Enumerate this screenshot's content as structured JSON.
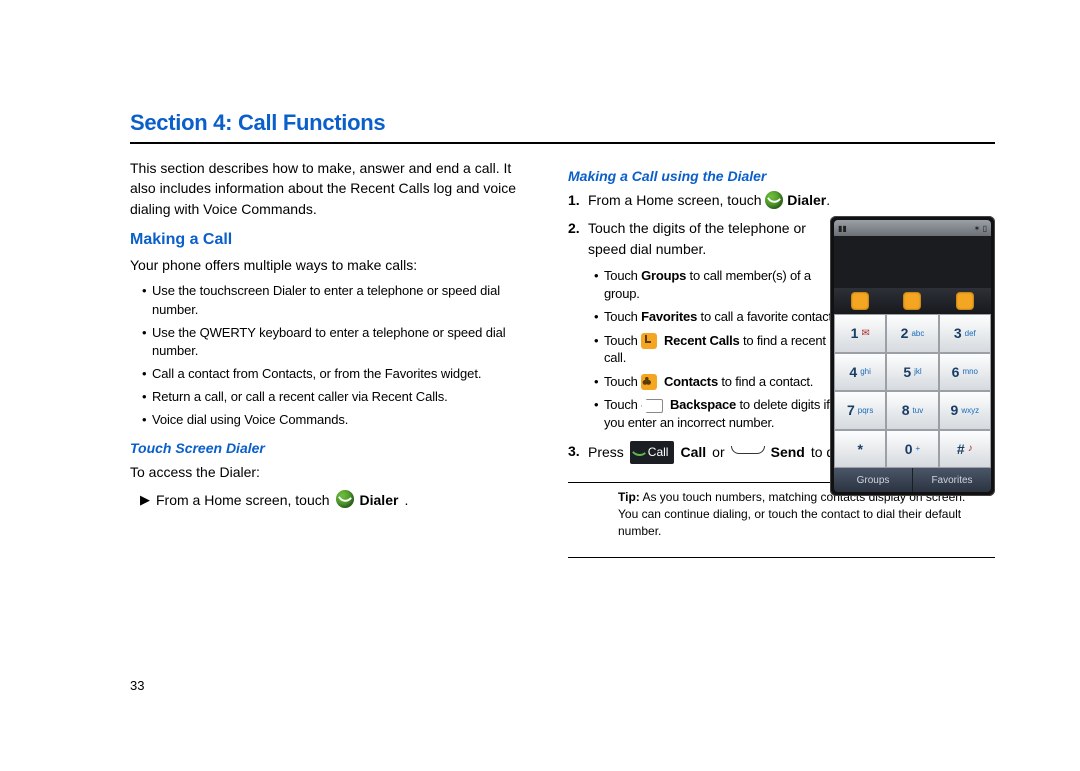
{
  "section_title": "Section 4: Call Functions",
  "intro": "This section describes how to make, answer and end a call. It also includes information about the Recent Calls log and voice dialing with Voice Commands.",
  "left": {
    "h_making": "Making a Call",
    "ways_intro": "Your phone offers multiple ways to make calls:",
    "bullets": [
      "Use the touchscreen Dialer to enter a telephone or speed dial number.",
      "Use the QWERTY keyboard to enter a telephone or speed dial number.",
      "Call a contact from Contacts, or from the Favorites widget.",
      "Return a call, or call a recent caller via Recent Calls.",
      "Voice dial using Voice Commands."
    ],
    "h_touch": "Touch Screen Dialer",
    "access": "To access the Dialer:",
    "step_prefix": "From a Home screen, touch",
    "dialer_label": "Dialer"
  },
  "right": {
    "h_using": "Making a Call using the Dialer",
    "step1_prefix": "From a Home screen, touch",
    "step1_bold": "Dialer",
    "step2": "Touch the digits of the telephone or speed dial number.",
    "sub": {
      "groups_a": "Touch ",
      "groups_b": "Groups",
      "groups_c": " to call member(s) of a group.",
      "fav_a": "Touch ",
      "fav_b": "Favorites",
      "fav_c": " to call a favorite contact.",
      "rec_a": "Touch ",
      "rec_b": "Recent Calls",
      "rec_c": " to find a recent call.",
      "con_a": "Touch ",
      "con_b": "Contacts",
      "con_c": " to find a contact.",
      "bk_a": "Touch ",
      "bk_b": "Backspace",
      "bk_c": " to delete digits if you enter an incorrect number."
    },
    "step3_press": "Press",
    "step3_call": "Call",
    "step3_callbold": "Call",
    "step3_or": "or",
    "step3_send": "Send",
    "step3_tail": " to dial the call.",
    "tip_label": "Tip:",
    "tip_text": " As you touch numbers, matching contacts display on screen.  You can continue dialing, or touch the contact to dial their default number."
  },
  "phone": {
    "keys": [
      {
        "d": "1",
        "t": "",
        "r": "✉"
      },
      {
        "d": "2",
        "t": "abc",
        "r": ""
      },
      {
        "d": "3",
        "t": "def",
        "r": ""
      },
      {
        "d": "4",
        "t": "ghi",
        "r": ""
      },
      {
        "d": "5",
        "t": "jkl",
        "r": ""
      },
      {
        "d": "6",
        "t": "mno",
        "r": ""
      },
      {
        "d": "7",
        "t": "pqrs",
        "r": ""
      },
      {
        "d": "8",
        "t": "tuv",
        "r": ""
      },
      {
        "d": "9",
        "t": "wxyz",
        "r": ""
      },
      {
        "d": "*",
        "t": "",
        "r": ""
      },
      {
        "d": "0",
        "t": "+",
        "r": ""
      },
      {
        "d": "#",
        "t": "",
        "r": "♪"
      }
    ],
    "btn_groups": "Groups",
    "btn_fav": "Favorites"
  },
  "page_number": "33"
}
